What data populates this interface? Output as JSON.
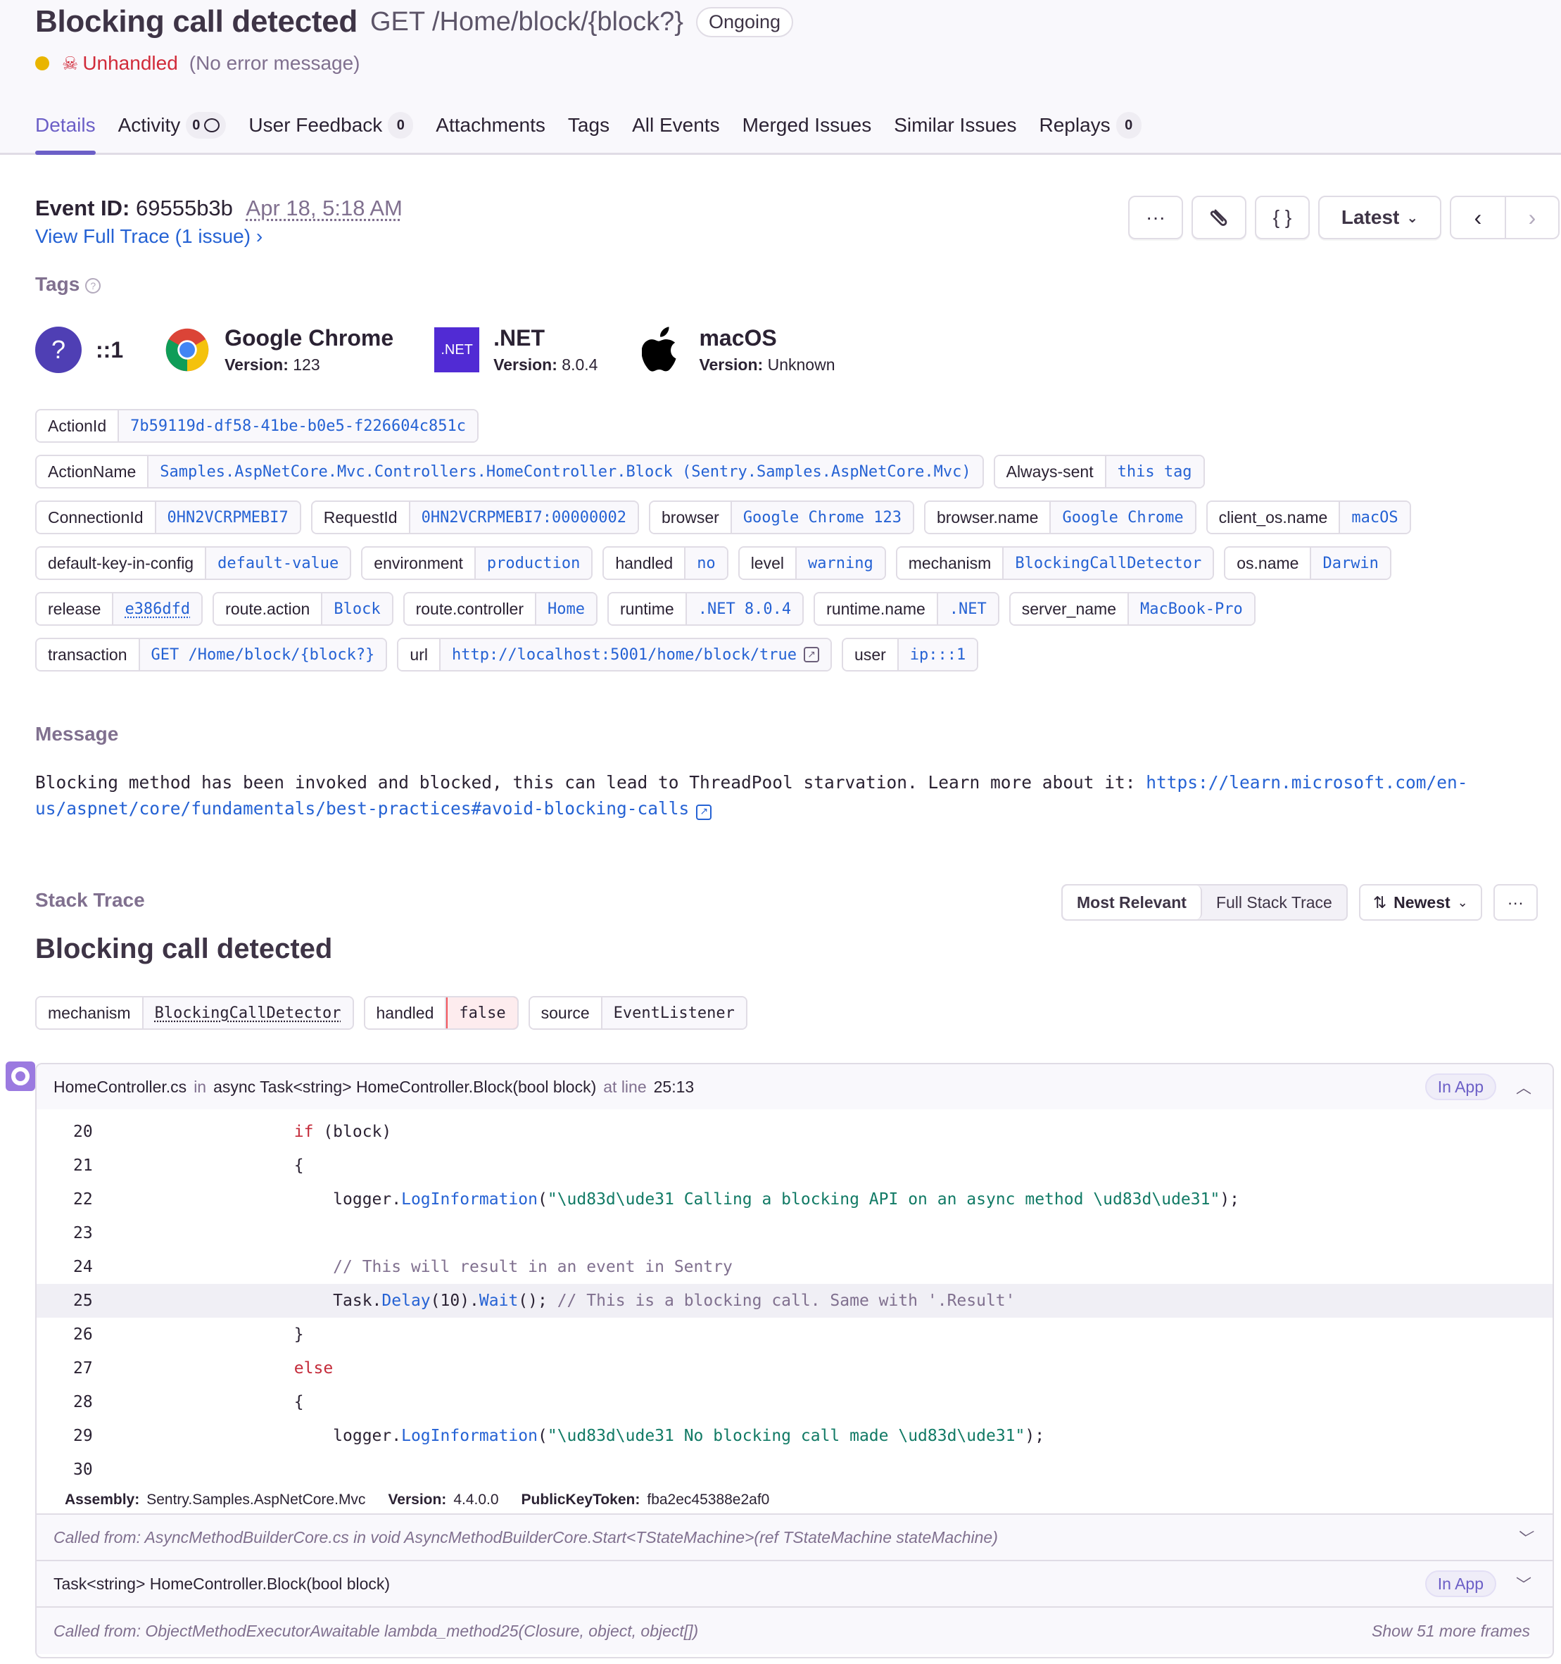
{
  "header": {
    "title": "Blocking call detected",
    "route": "GET /Home/block/{block?}",
    "status": "Ongoing",
    "level_color": "#e9b500",
    "unhandled_label": "Unhandled",
    "error_message": "(No error message)"
  },
  "tabs": [
    {
      "label": "Details",
      "active": true
    },
    {
      "label": "Activity",
      "badge": "0"
    },
    {
      "label": "User Feedback",
      "badge": "0"
    },
    {
      "label": "Attachments"
    },
    {
      "label": "Tags"
    },
    {
      "label": "All Events"
    },
    {
      "label": "Merged Issues"
    },
    {
      "label": "Similar Issues"
    },
    {
      "label": "Replays",
      "badge": "0"
    }
  ],
  "event": {
    "id_label": "Event ID:",
    "id": "69555b3b",
    "date": "Apr 18, 5:18 AM",
    "trace_link": "View Full Trace (1 issue)",
    "buttons": {
      "more": "more-icon",
      "attachments": "paperclip-icon",
      "json": "{ }",
      "latest": "Latest",
      "prev": "chevron-left-icon",
      "next": "chevron-right-icon"
    }
  },
  "tags_section": {
    "label": "Tags",
    "context": [
      {
        "icon": "unknown-user-icon",
        "glyph": "?",
        "title": "::1"
      },
      {
        "icon": "chrome-icon",
        "title": "Google Chrome",
        "version_label": "Version:",
        "version": "123"
      },
      {
        "icon": "dotnet-icon",
        "glyph": ".NET",
        "title": ".NET",
        "version_label": "Version:",
        "version": "8.0.4"
      },
      {
        "icon": "apple-icon",
        "title": "macOS",
        "version_label": "Version:",
        "version": "Unknown"
      }
    ],
    "rows": [
      [
        {
          "key": "ActionId",
          "value": "7b59119d-df58-41be-b0e5-f226604c851c"
        }
      ],
      [
        {
          "key": "ActionName",
          "value": "Samples.AspNetCore.Mvc.Controllers.HomeController.Block (Sentry.Samples.AspNetCore.Mvc)"
        },
        {
          "key": "Always-sent",
          "value": "this tag"
        }
      ],
      [
        {
          "key": "ConnectionId",
          "value": "0HN2VCRPMEBI7"
        },
        {
          "key": "RequestId",
          "value": "0HN2VCRPMEBI7:00000002"
        },
        {
          "key": "browser",
          "value": "Google Chrome 123"
        },
        {
          "key": "browser.name",
          "value": "Google Chrome"
        },
        {
          "key": "client_os.name",
          "value": "macOS"
        }
      ],
      [
        {
          "key": "default-key-in-config",
          "value": "default-value"
        },
        {
          "key": "environment",
          "value": "production"
        },
        {
          "key": "handled",
          "value": "no"
        },
        {
          "key": "level",
          "value": "warning"
        },
        {
          "key": "mechanism",
          "value": "BlockingCallDetector"
        },
        {
          "key": "os.name",
          "value": "Darwin"
        }
      ],
      [
        {
          "key": "release",
          "value": "e386dfd",
          "dotted": true
        },
        {
          "key": "route.action",
          "value": "Block"
        },
        {
          "key": "route.controller",
          "value": "Home"
        },
        {
          "key": "runtime",
          "value": ".NET 8.0.4"
        },
        {
          "key": "runtime.name",
          "value": ".NET"
        },
        {
          "key": "server_name",
          "value": "MacBook-Pro"
        }
      ],
      [
        {
          "key": "transaction",
          "value": "GET /Home/block/{block?}"
        },
        {
          "key": "url",
          "value": "http://localhost:5001/home/block/true",
          "external": true
        },
        {
          "key": "user",
          "value": "ip:::1"
        }
      ]
    ]
  },
  "message": {
    "label": "Message",
    "text": "Blocking method has been invoked and blocked, this can lead to ThreadPool starvation. Learn more about it: ",
    "link": "https://learn.microsoft.com/en-us/aspnet/core/fundamentals/best-practices#avoid-blocking-calls"
  },
  "stack_trace": {
    "label": "Stack Trace",
    "view_options": [
      "Most Relevant",
      "Full Stack Trace"
    ],
    "active_view": "Most Relevant",
    "sort": "Newest",
    "exception_title": "Blocking call detected",
    "mechanism_tags": [
      {
        "key": "mechanism",
        "value": "BlockingCallDetector"
      },
      {
        "key": "handled",
        "value": "false"
      },
      {
        "key": "source",
        "value": "EventListener"
      }
    ],
    "top_frame": {
      "file": "HomeController.cs",
      "in_label": "in",
      "function": "async Task<string> HomeController.Block(bool block)",
      "at_line_label": "at line",
      "line_col": "25:13",
      "badge": "In App",
      "highlight_line": 25,
      "lines": [
        {
          "n": "20",
          "tokens": [
            [
              "",
              "        "
            ],
            [
              "kw",
              "if"
            ],
            [
              "",
              " (block)"
            ]
          ]
        },
        {
          "n": "21",
          "tokens": [
            [
              "",
              "        {"
            ]
          ]
        },
        {
          "n": "22",
          "tokens": [
            [
              "",
              "            logger."
            ],
            [
              "fnc",
              "LogInformation"
            ],
            [
              "",
              "("
            ],
            [
              "str",
              "\"\\ud83d\\ude31 Calling a blocking API on an async method \\ud83d\\ude31\""
            ],
            [
              "",
              ");"
            ]
          ]
        },
        {
          "n": "23",
          "tokens": [
            [
              "",
              ""
            ]
          ]
        },
        {
          "n": "24",
          "tokens": [
            [
              "cm",
              "            // This will result in an event in Sentry"
            ]
          ]
        },
        {
          "n": "25",
          "tokens": [
            [
              "",
              "            Task."
            ],
            [
              "fnc",
              "Delay"
            ],
            [
              "",
              "(10)."
            ],
            [
              "fnc",
              "Wait"
            ],
            [
              "",
              "(); "
            ],
            [
              "cm",
              "// This is a blocking call. Same with '.Result'"
            ]
          ]
        },
        {
          "n": "26",
          "tokens": [
            [
              "",
              "        }"
            ]
          ]
        },
        {
          "n": "27",
          "tokens": [
            [
              "",
              "        "
            ],
            [
              "kw",
              "else"
            ]
          ]
        },
        {
          "n": "28",
          "tokens": [
            [
              "",
              "        {"
            ]
          ]
        },
        {
          "n": "29",
          "tokens": [
            [
              "",
              "            logger."
            ],
            [
              "fnc",
              "LogInformation"
            ],
            [
              "",
              "("
            ],
            [
              "str",
              "\"\\ud83d\\ude31 No blocking call made \\ud83d\\ude31\""
            ],
            [
              "",
              ");"
            ]
          ]
        },
        {
          "n": "30",
          "tokens": [
            [
              "",
              ""
            ]
          ]
        }
      ],
      "assembly": {
        "assembly_label": "Assembly:",
        "assembly": "Sentry.Samples.AspNetCore.Mvc",
        "version_label": "Version:",
        "version": "4.4.0.0",
        "token_label": "PublicKeyToken:",
        "token": "fba2ec45388e2af0"
      }
    },
    "other_frames": [
      {
        "type": "called",
        "text": "Called from: AsyncMethodBuilderCore.cs  in  void AsyncMethodBuilderCore.Start<TStateMachine>(ref TStateMachine stateMachine)"
      },
      {
        "type": "plain",
        "text": "Task<string> HomeController.Block(bool block)",
        "badge": "In App"
      },
      {
        "type": "called",
        "text": "Called from: ObjectMethodExecutorAwaitable lambda_method25(Closure, object, object[])",
        "more": "Show 51 more frames"
      }
    ]
  }
}
